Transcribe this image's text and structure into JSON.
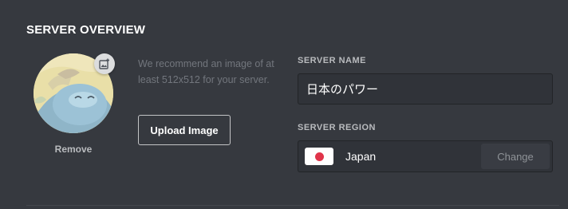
{
  "section": {
    "title": "SERVER OVERVIEW"
  },
  "avatar": {
    "remove_label": "Remove",
    "badge_icon": "add-image-icon"
  },
  "recommendation": {
    "text": "We recommend an image of at least 512x512 for your server.",
    "upload_label": "Upload Image"
  },
  "server_name": {
    "label": "SERVER NAME",
    "value": "日本のパワー"
  },
  "server_region": {
    "label": "SERVER REGION",
    "value": "Japan",
    "flag_icon": "japan-flag-icon",
    "change_label": "Change"
  },
  "colors": {
    "background": "#36393f",
    "input_background": "#303339",
    "muted_text": "#72767d",
    "label_text": "#b9bbbe",
    "flag_red": "#e0344a"
  }
}
